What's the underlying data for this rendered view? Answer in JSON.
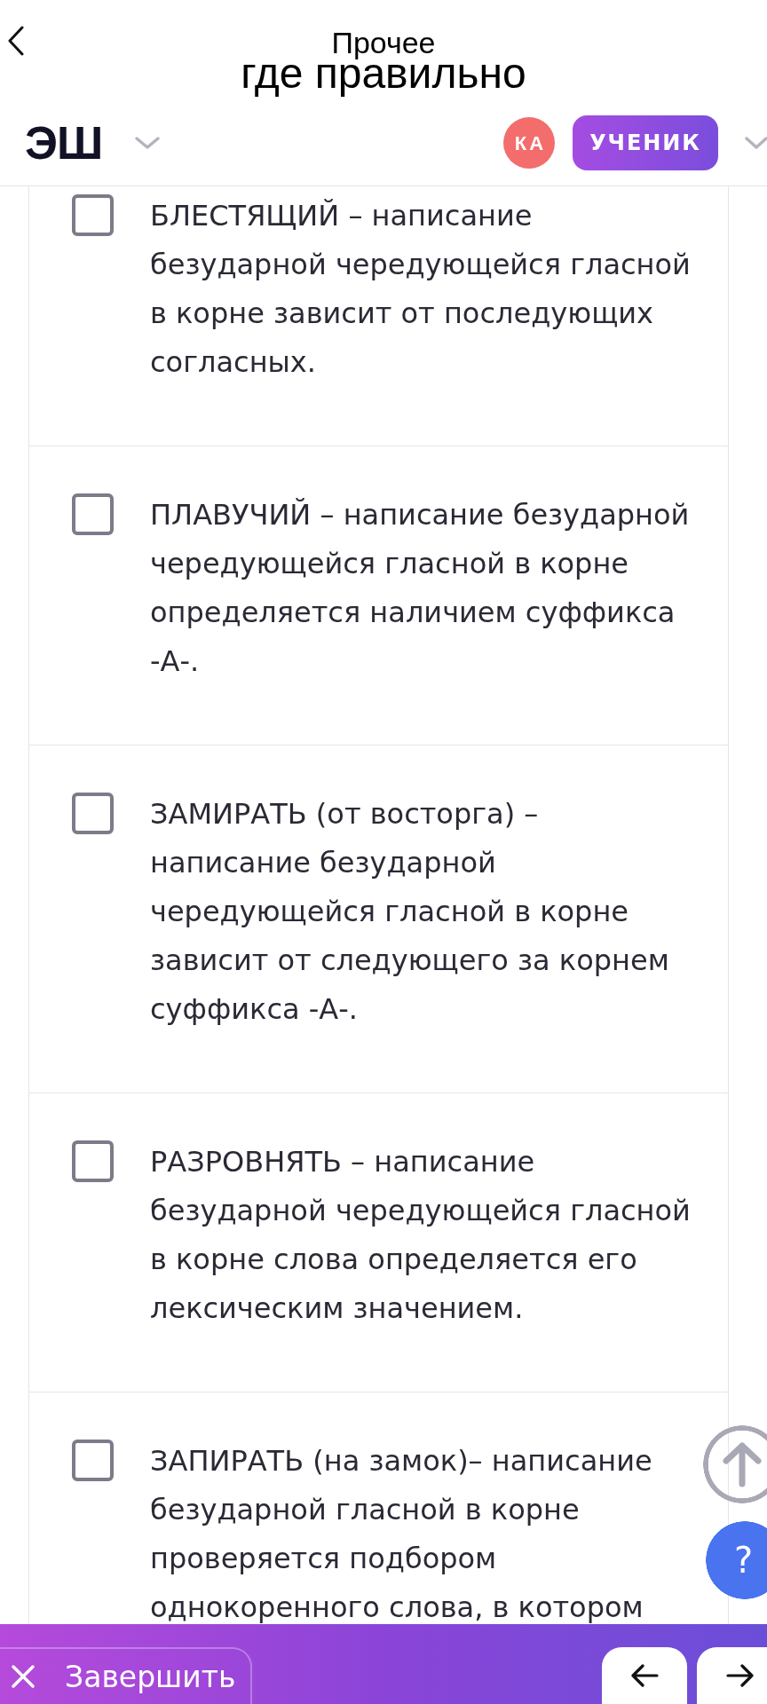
{
  "header": {
    "subtitle": "Прочее",
    "title": "где правильно"
  },
  "account_bar": {
    "logo": "ЭШ",
    "avatar_initials": "КА",
    "role": "УЧЕНИК"
  },
  "options": [
    {
      "text": "БЛЕСТЯЩИЙ – написание безударной чередующейся гласной в корне зависит от последующих согласных.",
      "checked": false
    },
    {
      "text": "ПЛАВУЧИЙ – написание безударной чередующейся гласной в корне определяется наличием суффикса -А-.",
      "checked": false
    },
    {
      "text": "ЗАМИРАТЬ (от восторга) – написание безударной чередующейся гласной в корне зависит от следующего за корнем суффикса -А-.",
      "checked": false
    },
    {
      "text": "РАЗРОВНЯТЬ – написание безударной чередующейся гласной в корне слова определяется его лексическим значением.",
      "checked": false
    },
    {
      "text": "ЗАПИРАТЬ (на замок)– написание безударной гласной в корне проверяется подбором однокоренного слова, в котором",
      "checked": false
    }
  ],
  "help_button": {
    "label": "?"
  },
  "bottom_bar": {
    "finish_label": "Завершить"
  }
}
